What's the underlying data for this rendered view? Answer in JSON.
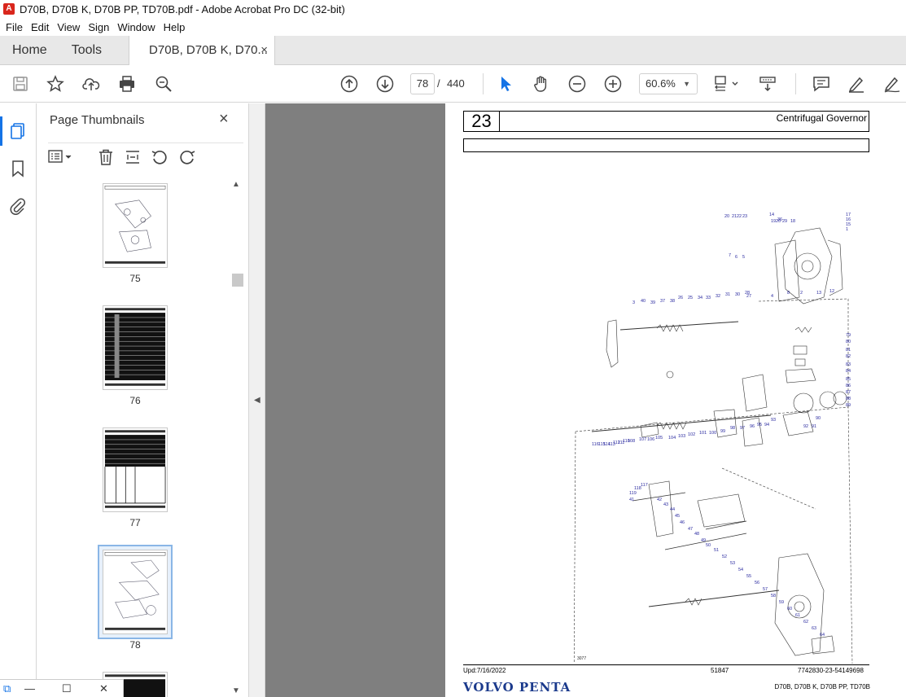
{
  "window": {
    "title": "D70B, D70B K, D70B PP, TD70B.pdf - Adobe Acrobat Pro DC (32-bit)"
  },
  "menu": {
    "items": [
      "File",
      "Edit",
      "View",
      "Sign",
      "Window",
      "Help"
    ]
  },
  "tabs": {
    "home": "Home",
    "tools": "Tools",
    "document": "D70B, D70B K, D70...",
    "close": "×"
  },
  "toolbar": {
    "page_current": "78",
    "page_separator": "/",
    "page_total": "440",
    "zoom": "60.6%"
  },
  "panel": {
    "title": "Page Thumbnails",
    "close": "×",
    "thumbnails": [
      {
        "number": "75"
      },
      {
        "number": "76"
      },
      {
        "number": "77"
      },
      {
        "number": "78"
      }
    ]
  },
  "document": {
    "section_number": "23",
    "section_title": "Centrifugal Governor",
    "updated": "Upd:7/16/2022",
    "code": "51847",
    "part_ref": "7742830-23-54149698",
    "brand": "VOLVO PENTA",
    "models": "D70B, D70B K, D70B PP, TD70B",
    "diagram_id": "3077",
    "callouts": [
      "20",
      "21",
      "22",
      "23",
      "14",
      "36",
      "19",
      "20",
      "29",
      "18",
      "17",
      "16",
      "15",
      "1",
      "7",
      "6",
      "5",
      "27",
      "4",
      "8",
      "2",
      "13",
      "12",
      "3",
      "40",
      "39",
      "37",
      "38",
      "26",
      "25",
      "34",
      "33",
      "32",
      "31",
      "30",
      "28",
      "79",
      "80",
      "81",
      "82",
      "83",
      "84",
      "85",
      "86",
      "87",
      "88",
      "89",
      "90",
      "91",
      "92",
      "93",
      "94",
      "95",
      "96",
      "97",
      "98",
      "99",
      "100",
      "101",
      "102",
      "103",
      "104",
      "105",
      "106",
      "107",
      "108",
      "110",
      "111",
      "112",
      "113",
      "114",
      "115",
      "116",
      "117",
      "118",
      "119",
      "41",
      "42",
      "43",
      "44",
      "45",
      "46",
      "47",
      "48",
      "49",
      "50",
      "51",
      "52",
      "53",
      "54",
      "55",
      "56",
      "57",
      "58",
      "59",
      "60",
      "61",
      "62",
      "63",
      "64"
    ]
  },
  "colors": {
    "accent": "#1473e6",
    "callout": "#2a2aa0",
    "brand": "#1b3a8c",
    "doc_bg": "#7f7f7f"
  }
}
